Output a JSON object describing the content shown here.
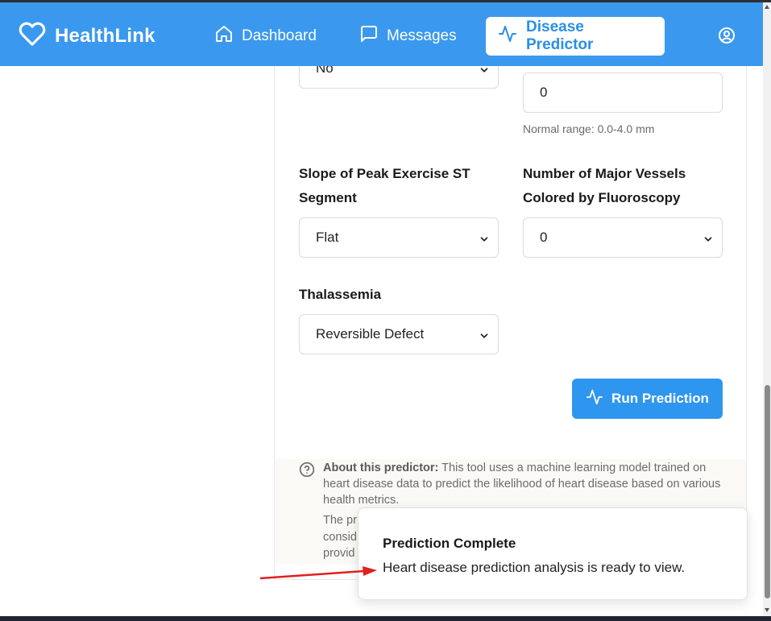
{
  "app": {
    "name": "HealthLink"
  },
  "nav": {
    "items": [
      {
        "label": "Dashboard",
        "icon": "home-icon"
      },
      {
        "label": "Messages",
        "icon": "message-icon"
      },
      {
        "label": "Disease Predictor",
        "icon": "activity-icon",
        "active": true
      }
    ],
    "profile_icon": "user-circle-icon"
  },
  "colors": {
    "primary": "#3a99ee",
    "button": "#2e96ef",
    "annotation_arrow": "#e02020"
  },
  "form": {
    "partial_select_value": "No",
    "st_depression": {
      "value": "0",
      "hint": "Normal range: 0.0-4.0 mm"
    },
    "slope": {
      "label": "Slope of Peak Exercise ST Segment",
      "value": "Flat"
    },
    "vessels": {
      "label": "Number of Major Vessels Colored by Fluoroscopy",
      "value": "0"
    },
    "thalassemia": {
      "label": "Thalassemia",
      "value": "Reversible Defect"
    },
    "run_button": "Run Prediction"
  },
  "about": {
    "title": "About this predictor:",
    "text": "This tool uses a machine learning model trained on heart disease data to predict the likelihood of heart disease based on various health metrics.",
    "text2_visible": "The pr\nconsid\nprovid"
  },
  "toast": {
    "title": "Prediction Complete",
    "description": "Heart disease prediction analysis is ready to view."
  }
}
